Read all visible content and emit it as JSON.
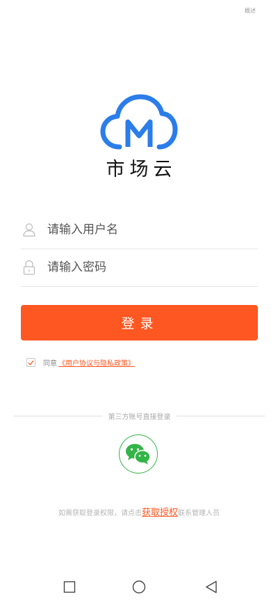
{
  "status_bar": {
    "corner_text": "概述"
  },
  "brand": {
    "logo_letter": "M",
    "name": "市场云",
    "color": "#2b7de9"
  },
  "form": {
    "username_placeholder": "请输入用户名",
    "password_placeholder": "请输入密码",
    "login_label": "登录"
  },
  "agreement": {
    "checked": true,
    "prefix": "同意",
    "link_text": "《用户协议与隐私政策》"
  },
  "third_party": {
    "divider_text": "第三方账号直接登录",
    "provider_icon": "wechat-icon"
  },
  "authorization": {
    "text_before": "如需获取登录权限，请点击",
    "link_text": "获取授权",
    "text_after": "联系管理人员"
  },
  "nav": {
    "icons": [
      "recent-apps-icon",
      "home-icon",
      "back-icon"
    ]
  },
  "colors": {
    "accent": "#ff5722",
    "brand_blue": "#2b7de9",
    "wechat_green": "#33b447"
  }
}
